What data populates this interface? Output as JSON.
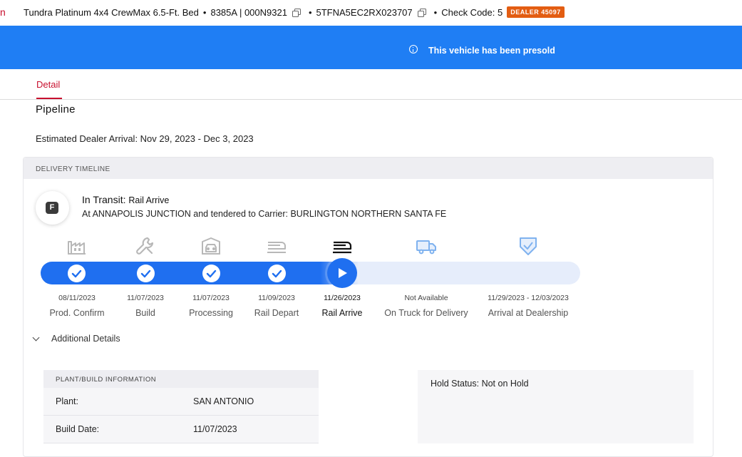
{
  "header": {
    "edge_glyph": "n",
    "model": "Tundra Platinum 4x4 CrewMax 6.5-Ft. Bed",
    "model_code": "8385A | 000N9321",
    "vin": "5TFNA5EC2RX023707",
    "check_code": "Check Code: 5",
    "dealer_badge": "DEALER 45097",
    "separator": "•"
  },
  "banner": {
    "message": "This vehicle has been presold",
    "icon": "info-icon",
    "color": "#1f7ef4"
  },
  "tabs": [
    {
      "label": "Detail",
      "active": true
    }
  ],
  "pipeline": {
    "title": "Pipeline",
    "estimated_arrival": "Estimated Dealer Arrival: Nov 29, 2023 - Dec 3, 2023"
  },
  "timeline": {
    "header": "DELIVERY TIMELINE",
    "status_letter": "F",
    "status_label": "In Transit:",
    "status_sub": "Rail Arrive",
    "status_detail": "At ANNAPOLIS JUNCTION and tendered to Carrier: BURLINGTON NORTHERN SANTA FE",
    "current_step_index": 4,
    "steps": [
      {
        "label": "Prod. Confirm",
        "date": "08/11/2023",
        "icon": "factory-icon",
        "state": "complete"
      },
      {
        "label": "Build",
        "date": "11/07/2023",
        "icon": "wrench-icon",
        "state": "complete"
      },
      {
        "label": "Processing",
        "date": "11/07/2023",
        "icon": "car-garage-icon",
        "state": "complete"
      },
      {
        "label": "Rail Depart",
        "date": "11/09/2023",
        "icon": "train-icon",
        "state": "complete"
      },
      {
        "label": "Rail Arrive",
        "date": "11/26/2023",
        "icon": "train-icon",
        "state": "current"
      },
      {
        "label": "On Truck for Delivery",
        "date": "Not Available",
        "icon": "truck-icon",
        "state": "upcoming"
      },
      {
        "label": "Arrival at Dealership",
        "date": "11/29/2023 - 12/03/2023",
        "icon": "shield-check-icon",
        "state": "upcoming"
      }
    ],
    "colors": {
      "complete": "#1f6ff0",
      "track": "#e6edfb",
      "upcoming_icon": "#7fb2ef",
      "done_icon": "#b8b8b8"
    }
  },
  "additional_details": {
    "toggle_label": "Additional Details",
    "plant": {
      "header": "PLANT/BUILD INFORMATION",
      "rows": [
        {
          "key": "Plant:",
          "value": "SAN ANTONIO"
        },
        {
          "key": "Build Date:",
          "value": "11/07/2023"
        }
      ]
    },
    "hold_status": "Hold Status: Not on Hold"
  }
}
